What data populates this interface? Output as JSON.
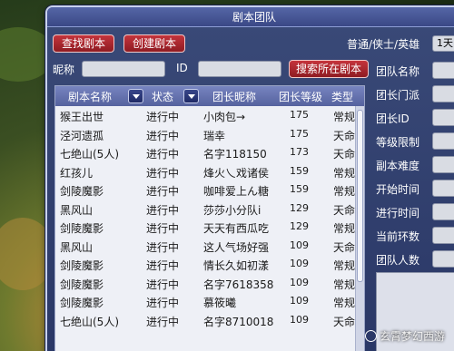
{
  "window": {
    "title": "剧本团队"
  },
  "toolbar": {
    "find_label": "查找剧本",
    "create_label": "创建剧本",
    "difficulty_label": "普通/侠士/英雄",
    "days_value": "1天"
  },
  "search": {
    "nick_label": "昵称",
    "id_label": "ID",
    "search_btn": "搜索所在剧本"
  },
  "table": {
    "headers": {
      "name": "剧本名称",
      "status": "状态",
      "leader": "团长昵称",
      "level": "团长等级",
      "type": "类型"
    },
    "rows": [
      {
        "name": "猴王出世",
        "status": "进行中",
        "leader": "小肉包→",
        "level": "175",
        "type": "常规"
      },
      {
        "name": "泾河遗孤",
        "status": "进行中",
        "leader": "瑞幸",
        "level": "175",
        "type": "天命"
      },
      {
        "name": "七绝山(5人)",
        "status": "进行中",
        "leader": "名字118150",
        "level": "173",
        "type": "天命"
      },
      {
        "name": "红孩儿",
        "status": "进行中",
        "leader": "烽火乀戏诸侯",
        "level": "159",
        "type": "常规"
      },
      {
        "name": "剑陵魔影",
        "status": "进行中",
        "leader": "咖啡爱上ん糖",
        "level": "159",
        "type": "常规"
      },
      {
        "name": "黑风山",
        "status": "进行中",
        "leader": "莎莎小分队i",
        "level": "129",
        "type": "天命"
      },
      {
        "name": "剑陵魔影",
        "status": "进行中",
        "leader": "天天有西瓜吃",
        "level": "129",
        "type": "常规"
      },
      {
        "name": "黑风山",
        "status": "进行中",
        "leader": "这人气场好强",
        "level": "109",
        "type": "天命"
      },
      {
        "name": "剑陵魔影",
        "status": "进行中",
        "leader": "情长久如初漾",
        "level": "109",
        "type": "常规"
      },
      {
        "name": "剑陵魔影",
        "status": "进行中",
        "leader": "名字7618358",
        "level": "109",
        "type": "常规"
      },
      {
        "name": "剑陵魔影",
        "status": "进行中",
        "leader": "慕筱曦",
        "level": "109",
        "type": "常规"
      },
      {
        "name": "七绝山(5人)",
        "status": "进行中",
        "leader": "名字8710018",
        "level": "109",
        "type": "天命"
      }
    ]
  },
  "right_panel": {
    "fields": [
      "团队名称",
      "团长门派",
      "团长ID",
      "等级限制",
      "副本难度",
      "开始时间",
      "进行时间",
      "当前环数",
      "团队人数"
    ]
  },
  "watermark": "玄霄梦幻西游"
}
